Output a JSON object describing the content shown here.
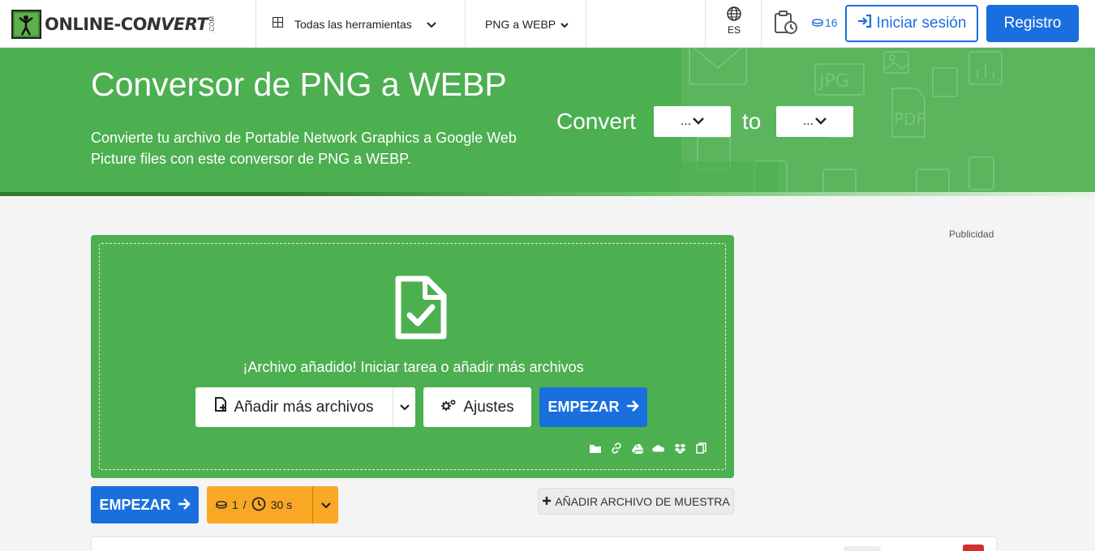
{
  "header": {
    "logo_text_1": "ONLINE-CO",
    "logo_text_2": "NVERT",
    "logo_com": ".COM",
    "tools_label": "Todas las herramientas",
    "converter_label": "PNG a WEBP",
    "language": "ES",
    "credits": "16",
    "login_label": "Iniciar sesión",
    "register_label": "Registro"
  },
  "hero": {
    "title": "Conversor de PNG a WEBP",
    "subtitle": "Convierte tu archivo de Portable Network Graphics a Google Web Picture files con este conversor de PNG a WEBP.",
    "convert_label": "Convert",
    "to_label": "to",
    "from_select": "...",
    "to_select": "..."
  },
  "ad_label": "Publicidad",
  "dropzone": {
    "message": "¡Archivo añadido! Iniciar tarea o añadir más archivos",
    "add_more_label": "Añadir más archivos",
    "settings_label": "Ajustes",
    "start_label": "EMPEZAR",
    "sources": [
      "folder-icon",
      "link-icon",
      "google-drive-icon",
      "onedrive-icon",
      "dropbox-icon",
      "clipboard-icon"
    ]
  },
  "actions": {
    "start_label": "EMPEZAR",
    "cost_credits": "1",
    "cost_sep": "/",
    "cost_time": "30 s",
    "sample_label": "AÑADIR ARCHIVO DE MUESTRA"
  },
  "colors": {
    "brand_green": "#4caf50",
    "primary_blue": "#1a6fde",
    "cost_orange": "#f9a825"
  }
}
